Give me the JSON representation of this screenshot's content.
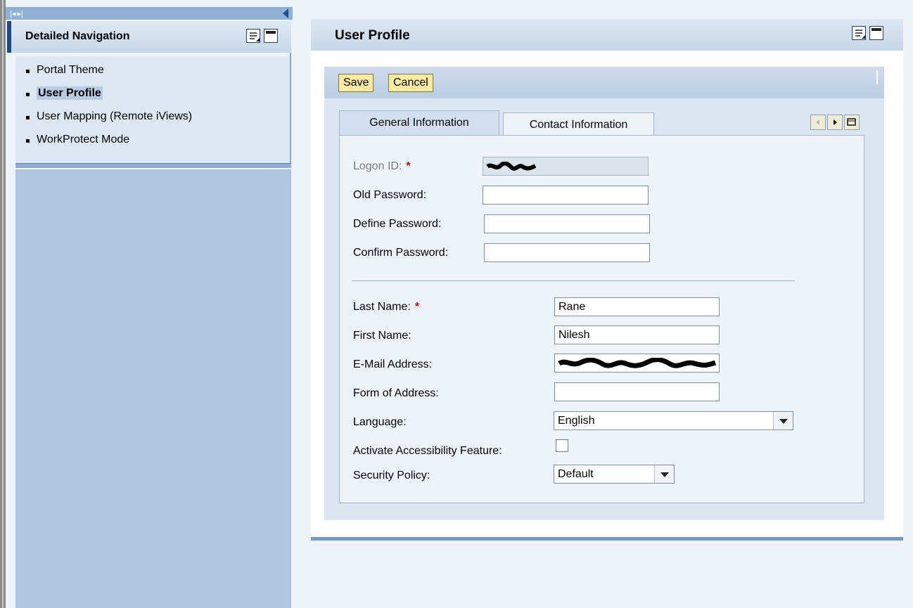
{
  "nav": {
    "title": "Detailed Navigation",
    "items": [
      {
        "label": "Portal Theme",
        "selected": false
      },
      {
        "label": "User Profile",
        "selected": true
      },
      {
        "label": "User Mapping (Remote iViews)",
        "selected": false
      },
      {
        "label": "WorkProtect Mode",
        "selected": false
      }
    ]
  },
  "main": {
    "title": "User Profile",
    "toolbar": {
      "save_label": "Save",
      "cancel_label": "Cancel"
    },
    "tabs": [
      {
        "label": "General Information",
        "active": true
      },
      {
        "label": "Contact Information",
        "active": false
      }
    ],
    "form": {
      "logon_id": {
        "label": "Logon ID:",
        "required_mark": "*",
        "value": ""
      },
      "old_password": {
        "label": "Old Password:",
        "value": ""
      },
      "define_password": {
        "label": "Define Password:",
        "value": ""
      },
      "confirm_password": {
        "label": "Confirm Password:",
        "value": ""
      },
      "last_name": {
        "label": "Last Name:",
        "required_mark": "*",
        "value": "Rane"
      },
      "first_name": {
        "label": "First Name:",
        "value": "Nilesh"
      },
      "email": {
        "label": "E-Mail Address:",
        "value": ""
      },
      "form_of_address": {
        "label": "Form of Address:",
        "value": ""
      },
      "language": {
        "label": "Language:",
        "value": "English"
      },
      "accessibility": {
        "label": "Activate Accessibility Feature:",
        "checked": false
      },
      "security_policy": {
        "label": "Security Policy:",
        "value": "Default"
      }
    }
  },
  "colors": {
    "accent": "#1d4a83",
    "button_bg": "#fbe9a6",
    "required": "#cc0000"
  }
}
